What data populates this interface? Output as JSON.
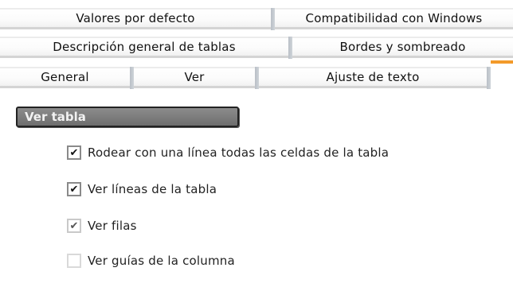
{
  "tabs": {
    "row1": [
      "Valores por defecto",
      "Compatibilidad con Windows"
    ],
    "row2": [
      "Descripción general de tablas",
      "Bordes y sombreado"
    ],
    "row3": [
      "General",
      "Ver",
      "Ajuste de texto"
    ]
  },
  "section": {
    "title": "Ver tabla"
  },
  "options": [
    {
      "label": "Rodear con una línea todas las celdas de la tabla",
      "checked": true,
      "style": "checked"
    },
    {
      "label": "Ver líneas de la tabla",
      "checked": true,
      "style": "checked"
    },
    {
      "label": "Ver filas",
      "checked": true,
      "style": "light"
    },
    {
      "label": "Ver guías de la columna",
      "checked": false,
      "style": "empty"
    }
  ],
  "accent_color": "#f39a2a"
}
